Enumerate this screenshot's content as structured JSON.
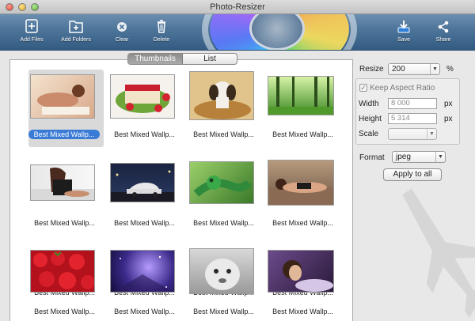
{
  "window": {
    "title": "Photo-Resizer"
  },
  "toolbar": {
    "add_files": "Add Files",
    "add_folders": "Add Folders",
    "clear": "Clear",
    "delete": "Delete",
    "save": "Save",
    "share": "Share"
  },
  "view_tabs": [
    {
      "label": "Thumbnails",
      "active": true
    },
    {
      "label": "List",
      "active": false
    }
  ],
  "thumbnails": [
    {
      "caption": "Best Mixed Wallp...",
      "selected": true,
      "subject": "woman lying"
    },
    {
      "caption": "Best Mixed Wallp...",
      "selected": false,
      "subject": "strawberry cake"
    },
    {
      "caption": "Best Mixed Wallp...",
      "selected": false,
      "subject": "puppy in basket"
    },
    {
      "caption": "Best Mixed Wallp...",
      "selected": false,
      "subject": "green forest"
    },
    {
      "caption": "Best Mixed Wallp...",
      "selected": false,
      "subject": "woman on bed"
    },
    {
      "caption": "Best Mixed Wallp...",
      "selected": false,
      "subject": "car at night"
    },
    {
      "caption": "Best Mixed Wallp...",
      "selected": false,
      "subject": "green lizard"
    },
    {
      "caption": "Best Mixed Wallp...",
      "selected": false,
      "subject": "woman lying"
    },
    {
      "caption": "",
      "selected": false,
      "subject": "strawberries"
    },
    {
      "caption": "",
      "selected": false,
      "subject": "space nebula"
    },
    {
      "caption": "",
      "selected": false,
      "subject": "baby face"
    },
    {
      "caption": "",
      "selected": false,
      "subject": "woman portrait"
    }
  ],
  "settings": {
    "resize_label": "Resize",
    "resize_value": "200",
    "resize_unit": "%",
    "keep_aspect_label": "Keep Aspect Ratio",
    "keep_aspect_checked": true,
    "width_label": "Width",
    "width_value": "8 000",
    "width_unit": "px",
    "height_label": "Height",
    "height_value": "5 314",
    "height_unit": "px",
    "scale_label": "Scale",
    "scale_value": "",
    "format_label": "Format",
    "format_value": "jpeg",
    "apply_label": "Apply to all"
  },
  "colors": {
    "accent": "#3a7bd6",
    "toolbar": "#4c7398"
  }
}
